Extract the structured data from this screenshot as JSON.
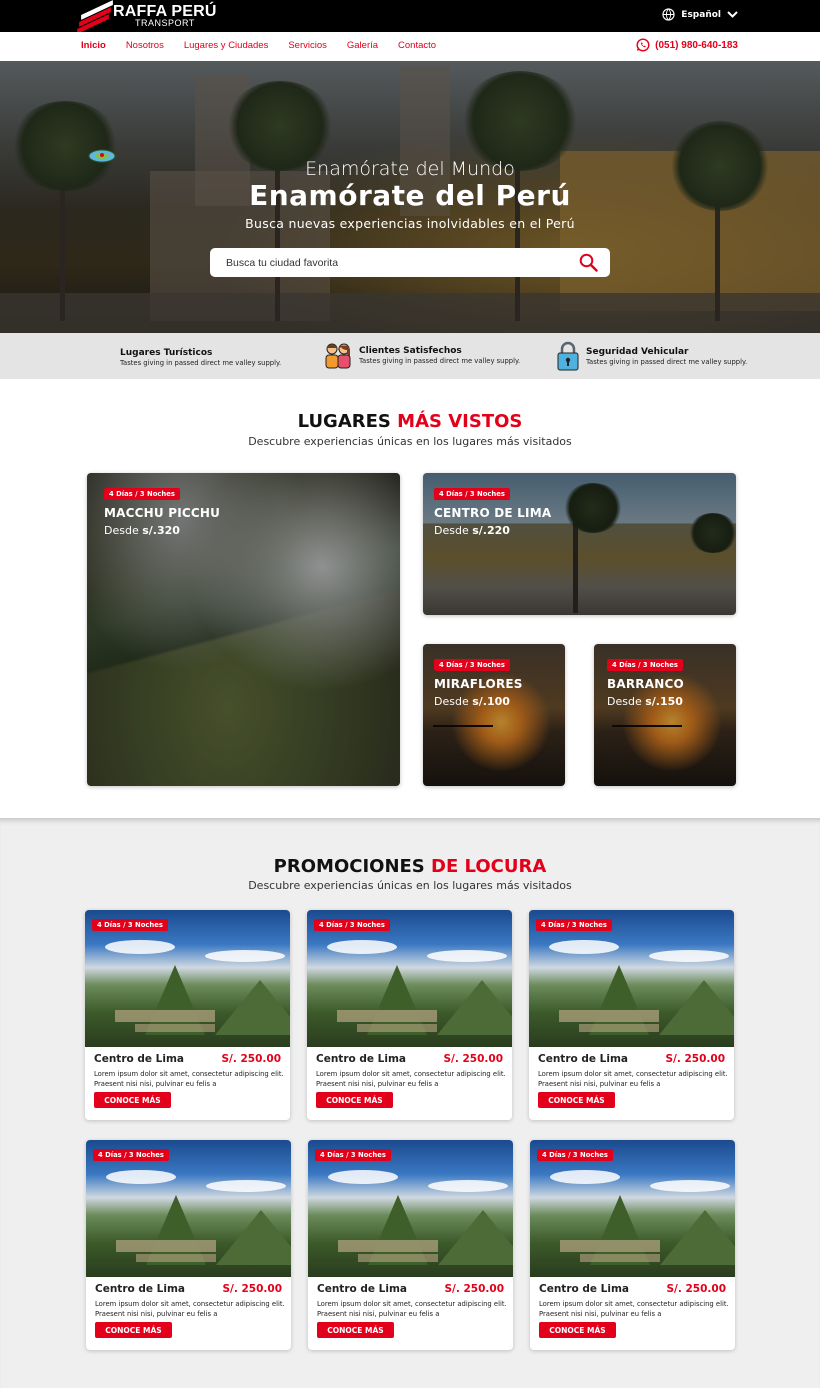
{
  "brand": {
    "name": "RAFFA PERÚ",
    "sub": "TRANSPORT"
  },
  "language": {
    "label": "Español"
  },
  "nav": {
    "items": [
      {
        "label": "Inicio"
      },
      {
        "label": "Nosotros"
      },
      {
        "label": "Lugares y Ciudades"
      },
      {
        "label": "Servicios"
      },
      {
        "label": "Galería"
      },
      {
        "label": "Contacto"
      }
    ],
    "phone": "(051) 980-640-183"
  },
  "hero": {
    "pre_title": "Enamórate del Mundo",
    "title": "Enamórate del Perú",
    "subtitle": "Busca nuevas experiencias inolvidables en el Perú",
    "search_placeholder": "Busca tu ciudad favorita"
  },
  "features": [
    {
      "title": "Lugares Turísticos",
      "desc": "Tastes giving in passed direct me valley supply."
    },
    {
      "title": "Clientes Satisfechos",
      "desc": "Tastes giving in passed direct me valley supply."
    },
    {
      "title": "Seguridad Vehicular",
      "desc": "Tastes giving in passed direct me valley supply."
    }
  ],
  "popular": {
    "title_plain": "LUGARES ",
    "title_highlight": "MÁS VISTOS",
    "subtitle": "Descubre experiencias únicas en los lugares más visitados",
    "cards": [
      {
        "tag": "4 Días / 3 Noches",
        "name": "MACCHU PICCHU",
        "desde": "Desde",
        "price": "s/.320"
      },
      {
        "tag": "4 Días / 3 Noches",
        "name": "CENTRO DE LIMA",
        "desde": "Desde",
        "price": "s/.220"
      },
      {
        "tag": "4 Días / 3 Noches",
        "name": "MIRAFLORES",
        "desde": "Desde",
        "price": "s/.100"
      },
      {
        "tag": "4 Días / 3 Noches",
        "name": "BARRANCO",
        "desde": "Desde",
        "price": "s/.150"
      }
    ]
  },
  "promos": {
    "title_plain": "PROMOCIONES ",
    "title_highlight": "DE LOCURA",
    "subtitle": "Descubre experiencias únicas en los lugares más visitados",
    "cards": [
      {
        "tag": "4 Días / 3 Noches",
        "title": "Centro de Lima",
        "price": "S/. 250.00",
        "desc": "Lorem ipsum dolor sit amet, consectetur adipiscing elit. Praesent nisi nisi, pulvinar eu felis a",
        "button": "CONOCE MÁS"
      },
      {
        "tag": "4 Días / 3 Noches",
        "title": "Centro de Lima",
        "price": "S/. 250.00",
        "desc": "Lorem ipsum dolor sit amet, consectetur adipiscing elit. Praesent nisi nisi, pulvinar eu felis a",
        "button": "CONOCE MÁS"
      },
      {
        "tag": "4 Días / 3 Noches",
        "title": "Centro de Lima",
        "price": "S/. 250.00",
        "desc": "Lorem ipsum dolor sit amet, consectetur adipiscing elit. Praesent nisi nisi, pulvinar eu felis a",
        "button": "CONOCE MÁS"
      },
      {
        "tag": "4 Días / 3 Noches",
        "title": "Centro de Lima",
        "price": "S/. 250.00",
        "desc": "Lorem ipsum dolor sit amet, consectetur adipiscing elit. Praesent nisi nisi, pulvinar eu felis a",
        "button": "CONOCE MÁS"
      },
      {
        "tag": "4 Días / 3 Noches",
        "title": "Centro de Lima",
        "price": "S/. 250.00",
        "desc": "Lorem ipsum dolor sit amet, consectetur adipiscing elit. Praesent nisi nisi, pulvinar eu felis a",
        "button": "CONOCE MÁS"
      },
      {
        "tag": "4 Días / 3 Noches",
        "title": "Centro de Lima",
        "price": "S/. 250.00",
        "desc": "Lorem ipsum dolor sit amet, consectetur adipiscing elit. Praesent nisi nisi, pulvinar eu felis a",
        "button": "CONOCE MÁS"
      }
    ]
  },
  "colors": {
    "accent": "#e2001a",
    "topbar": "#000000",
    "feature_band": "#e4e4e4",
    "promo_bg": "#efefef"
  },
  "icons": {
    "language": "globe-icon",
    "language_toggle": "chevron-down-icon",
    "phone": "whatsapp-icon",
    "search": "search-icon",
    "feature_people": "people-icon",
    "feature_security": "padlock-icon"
  }
}
